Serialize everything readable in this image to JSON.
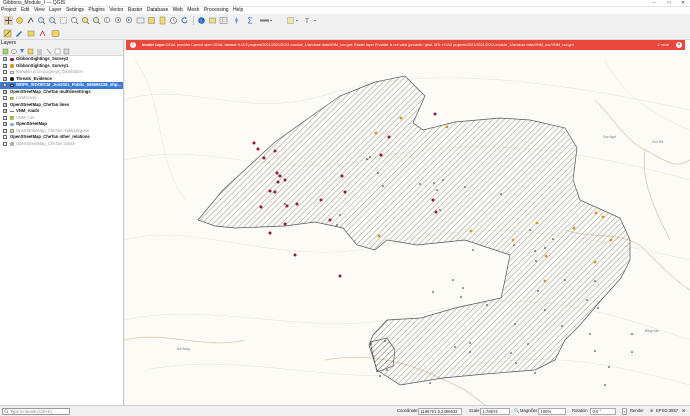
{
  "window": {
    "title": "Gibbons_Module_I — QGIS"
  },
  "menu": [
    "Project",
    "Edit",
    "View",
    "Layer",
    "Settings",
    "Plugins",
    "Vector",
    "Raster",
    "Database",
    "Web",
    "Mesh",
    "Processing",
    "Help"
  ],
  "layers_panel": {
    "title": "Layers",
    "items": [
      {
        "label": "GibbonSightings_Survey2",
        "checked": true,
        "bold": true,
        "symbol": "dot-red"
      },
      {
        "label": "GibbonSightings_Survey1",
        "checked": true,
        "bold": true,
        "symbol": "dot-orange"
      },
      {
        "label": "Nomascus Leucogenys_Distribution",
        "checked": false,
        "bold": false,
        "symbol": "box"
      },
      {
        "label": "Threats_Evidence",
        "checked": true,
        "bold": true,
        "symbol": "dot-dark"
      },
      {
        "label": "WDPA_WDOECM_Jun2021_Public_555594126_shp...",
        "checked": true,
        "bold": true,
        "symbol": "hatch",
        "selected": true
      },
      {
        "label": "OpenStreetMap_CheTan multilinestrings",
        "checked": true,
        "bold": true,
        "symbol": "none"
      },
      {
        "label": "LandCover",
        "checked": false,
        "bold": false,
        "symbol": "raster"
      },
      {
        "label": "OpenStreetMap_CheTan lines",
        "checked": true,
        "bold": true,
        "symbol": "none"
      },
      {
        "label": "VNM_roads",
        "checked": true,
        "bold": true,
        "symbol": "line"
      },
      {
        "label": "VNM_cov",
        "checked": false,
        "bold": false,
        "symbol": "raster"
      },
      {
        "label": "OpenStreetMap",
        "checked": true,
        "bold": true,
        "symbol": "globe"
      },
      {
        "label": "OpenStreetMap_CheTan multipolygons",
        "checked": false,
        "bold": false,
        "symbol": "fill-yellow"
      },
      {
        "label": "OpenStreetMap_CheTan other_relations",
        "checked": false,
        "bold": true,
        "symbol": "none"
      },
      {
        "label": "OpenStreetMap_CheTan points",
        "checked": false,
        "bold": false,
        "symbol": "dot-grey"
      }
    ]
  },
  "message_bar": {
    "title": "Invalid Layer:",
    "message": "GDAL provider Cannot open GDAL dataset H:/Z/2 projects/2021/2021/Z/2/2-module_1/landuse data/VNM_cov.grd: Raster layer Provider is not valid (provider: gdal, URI: H:/Z/2 projects/2021/2021/Z/2/2-module_1/landuse data/VNM_cov/VNM_cov.grd",
    "more": "2 more",
    "close_icon": "close-icon"
  },
  "status_bar": {
    "locator_placeholder": "Type to locate (Ctrl+K)",
    "coordinate_label": "Coordinate",
    "coordinate": "1196701.5,2486633",
    "scale_label": "Scale",
    "scale": "1:76674",
    "magnifier_label": "Magnifier",
    "magnifier": "100%",
    "rotation_label": "Rotation",
    "rotation": "0.0 °",
    "render_label": "Render",
    "crs": "EPSG:3857"
  },
  "colors": {
    "message_bar": "#e8473b",
    "selection": "#3a7bd5",
    "survey2_points": "#8e1c2f",
    "survey1_points": "#d9921a",
    "threat_points": "#222222"
  }
}
